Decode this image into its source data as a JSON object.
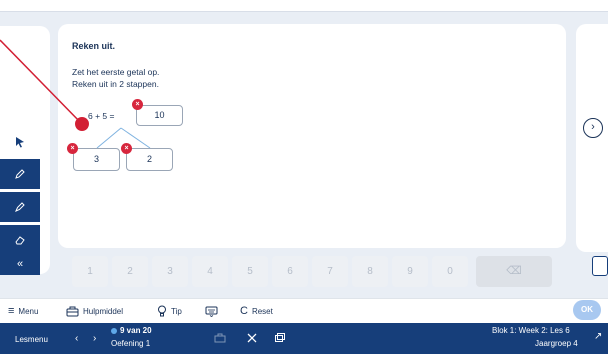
{
  "exercise": {
    "title": "Reken uit.",
    "instruction_1": "Zet het eerste getal op.",
    "instruction_2": "Reken uit in 2 stappen.",
    "equation": "6 + 5 =",
    "answer": "10",
    "split_left": "3",
    "split_right": "2",
    "error_mark": "×"
  },
  "keypad": {
    "keys": [
      "1",
      "2",
      "3",
      "4",
      "5",
      "6",
      "7",
      "8",
      "9",
      "0"
    ],
    "delete_symbol": "⌫"
  },
  "toolbar": {
    "menu": "Menu",
    "hulpmiddel": "Hulpmiddel",
    "tip": "Tip",
    "reset": "Reset",
    "ok": "OK"
  },
  "statusbar": {
    "lesmenu": "Lesmenu",
    "progress": "9 van 20",
    "exercise_label": "Oefening 1",
    "lesson": "Blok 1: Week 2: Les 6",
    "grade": "Jaargroep 4"
  },
  "colors": {
    "navy": "#163e7a",
    "error_red": "#d7263d",
    "annotation_red": "#d21f34"
  }
}
